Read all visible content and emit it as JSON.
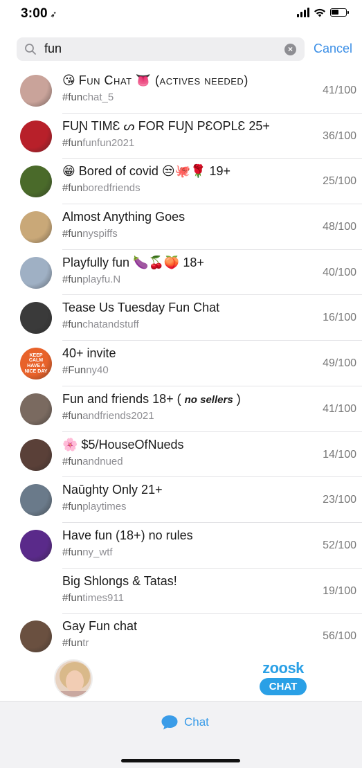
{
  "status_bar": {
    "time": "3:00",
    "location_glyph": "➶"
  },
  "search": {
    "query": "fun",
    "cancel_label": "Cancel"
  },
  "chats": [
    {
      "title_pre": "😘",
      "title": "Fun Chat",
      "title_post": "👅 (actives needed)",
      "tag_match": "#fun",
      "tag_rest": "chat_5",
      "count": "41/100",
      "avatar_color": "#c9a39a",
      "style": "smallcaps"
    },
    {
      "title_pre": "",
      "title": "FUƝ TIMƐ ᔕ FOR FUƝ PƐOPLƐ 25+",
      "title_post": "",
      "tag_match": "#fun",
      "tag_rest": "funfun2021",
      "count": "36/100",
      "avatar_color": "#b8202a"
    },
    {
      "title_pre": "😁",
      "title": "Bored of covid",
      "title_post": "😒🐙🌹 19+",
      "tag_match": "#fun",
      "tag_rest": "boredfriends",
      "count": "25/100",
      "avatar_color": "#4a6a2a"
    },
    {
      "title_pre": "",
      "title": "Almost Anything Goes",
      "title_post": "",
      "tag_match": "#fun",
      "tag_rest": "nyspiffs",
      "count": "48/100",
      "avatar_color": "#c9a878"
    },
    {
      "title_pre": "",
      "title": "Playfully fun",
      "title_post": "🍆🍒🍑 18+",
      "tag_match": "#fun",
      "tag_rest": "playfu.N",
      "count": "40/100",
      "avatar_color": "#9fb0c4"
    },
    {
      "title_pre": "",
      "title": "Tease Us Tuesday Fun Chat",
      "title_post": "",
      "tag_match": "#fun",
      "tag_rest": "chatandstuff",
      "count": "16/100",
      "avatar_color": "#3a3a3a"
    },
    {
      "title_pre": "",
      "title": "40+ invite",
      "title_post": "",
      "tag_match": "#Fun",
      "tag_rest": "ny40",
      "count": "49/100",
      "avatar_color": "#e8622a",
      "avatar_text": "KEEP CALM HAVE A NICE DAY"
    },
    {
      "title_pre": "",
      "title": "Fun and friends 18+  (",
      "title_ital": "no sellers",
      "title_post": ")",
      "tag_match": "#fun",
      "tag_rest": "andfriends2021",
      "count": "41/100",
      "avatar_color": "#7a6a60"
    },
    {
      "title_pre": "🌸",
      "title": "$5/HouseOfNueds",
      "title_post": "",
      "tag_match": "#fun",
      "tag_rest": "andnued",
      "count": "14/100",
      "avatar_color": "#5a4038"
    },
    {
      "title_pre": "",
      "title": "Naūghty Only 21+",
      "title_post": "",
      "tag_match": "#fun",
      "tag_rest": "playtimes",
      "count": "23/100",
      "avatar_color": "#6a7a8a"
    },
    {
      "title_pre": "",
      "title": "Have fun (18+) no rules",
      "title_post": "",
      "tag_match": "#fun",
      "tag_rest": "ny_wtf",
      "count": "52/100",
      "avatar_color": "#5a2a8a"
    },
    {
      "title_pre": "",
      "title": "Big Shlongs & Tatas!",
      "title_post": "",
      "tag_match": "#fun",
      "tag_rest": "times911",
      "count": "19/100",
      "avatar_color": "#ffffff"
    },
    {
      "title_pre": "",
      "title": "Gay Fun chat",
      "title_post": "",
      "tag_match": "#fun",
      "tag_rest": "tr",
      "count": "56/100",
      "avatar_color": "#6a5040"
    }
  ],
  "footer": {
    "zoosk_brand": "zoosk",
    "zoosk_cta": "CHAT"
  },
  "tabbar": {
    "chat_label": "Chat"
  },
  "colors": {
    "accent": "#3a8ee6",
    "zoosk_blue": "#2aa0e6"
  }
}
